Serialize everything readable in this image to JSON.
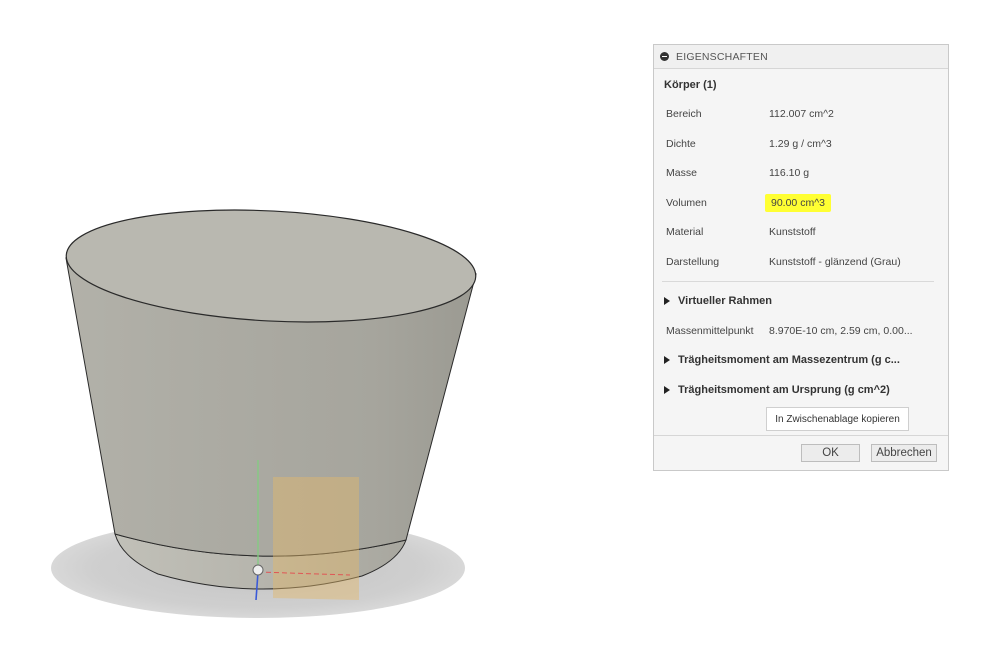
{
  "panel": {
    "header": "EIGENSCHAFTEN",
    "body_title": "Körper (1)",
    "properties": [
      {
        "key": "Bereich",
        "value": "112.007 cm^2"
      },
      {
        "key": "Dichte",
        "value": "1.29 g / cm^3"
      },
      {
        "key": "Masse",
        "value": "116.10 g"
      },
      {
        "key": "Volumen",
        "value": "90.00 cm^3"
      },
      {
        "key": "Material",
        "value": "Kunststoff"
      },
      {
        "key": "Darstellung",
        "value": "Kunststoff - glänzend (Grau)"
      }
    ],
    "section_virtual_frame": "Virtueller Rahmen",
    "center_of_mass": {
      "key": "Massenmittelpunkt",
      "value": "8.970E-10 cm, 2.59 cm, 0.00..."
    },
    "section_inertia_mass": "Trägheitsmoment am Massezentrum  (g c...",
    "section_inertia_origin": "Trägheitsmoment am Ursprung  (g cm^2)",
    "copy_button": "In Zwischenablage kopieren",
    "ok_button": "OK",
    "cancel_button": "Abbrechen",
    "highlight_color": "#ffff33"
  }
}
